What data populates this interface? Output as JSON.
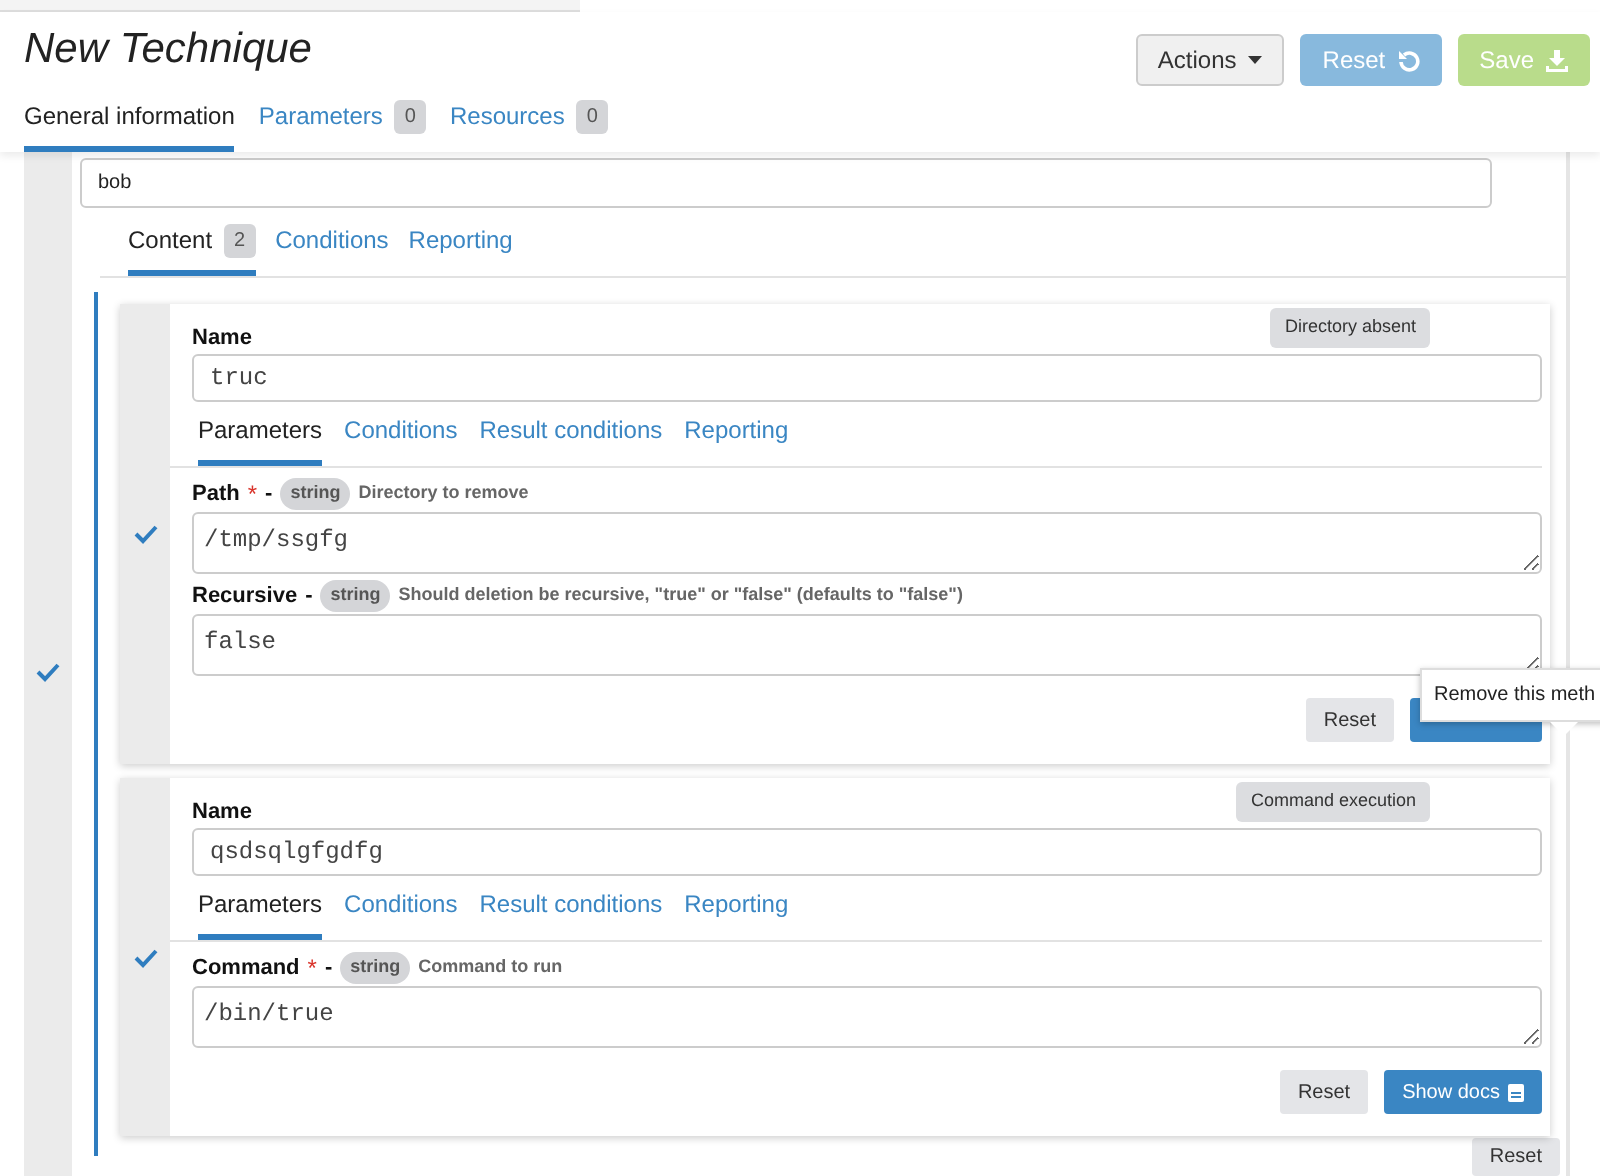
{
  "header": {
    "title": "New Technique",
    "actions": [
      {
        "label": "Actions",
        "kind": "dropdown",
        "disabled": false
      },
      {
        "label": "Reset",
        "kind": "reset",
        "disabled": true
      },
      {
        "label": "Save",
        "kind": "save",
        "disabled": true
      }
    ]
  },
  "tabs": [
    {
      "label": "General information",
      "selected": true
    },
    {
      "label": "Parameters",
      "count": "0",
      "selected": false
    },
    {
      "label": "Resources",
      "count": "0",
      "selected": false
    }
  ],
  "description": {
    "value": "bob"
  },
  "content_tabs": [
    {
      "label": "Content",
      "count": "2",
      "selected": true
    },
    {
      "label": "Conditions",
      "selected": false
    },
    {
      "label": "Reporting",
      "selected": false
    }
  ],
  "methods_valid": true,
  "methods": [
    {
      "badge": "Directory absent",
      "name_label": "Name",
      "name": "truc",
      "valid": true,
      "tabs": [
        {
          "label": "Parameters",
          "selected": true
        },
        {
          "label": "Conditions",
          "selected": false
        },
        {
          "label": "Result conditions",
          "selected": false
        },
        {
          "label": "Reporting",
          "selected": false
        }
      ],
      "parameters": [
        {
          "label": "Path",
          "required_mark": "*",
          "separator": "-",
          "type": "string",
          "description": "Directory to remove",
          "value": "/tmp/ssgfg"
        },
        {
          "label": "Recursive",
          "separator": "-",
          "type": "string",
          "description": "Should deletion be recursive, \"true\" or \"false\" (defaults to \"false\")",
          "value": "false"
        }
      ],
      "buttons": [
        {
          "label": "Reset",
          "kind": "plain"
        },
        {
          "kind": "primary"
        }
      ],
      "tooltip": "Remove this meth"
    },
    {
      "badge": "Command execution",
      "name_label": "Name",
      "name": "qsdsqlgfgdfg",
      "valid": true,
      "tabs": [
        {
          "label": "Parameters",
          "selected": true
        },
        {
          "label": "Conditions",
          "selected": false
        },
        {
          "label": "Result conditions",
          "selected": false
        },
        {
          "label": "Reporting",
          "selected": false
        }
      ],
      "parameters": [
        {
          "label": "Command",
          "required_mark": "*",
          "separator": "-",
          "type": "string",
          "description": "Command to run",
          "value": "/bin/true"
        }
      ],
      "buttons": [
        {
          "label": "Reset",
          "kind": "plain"
        },
        {
          "label": "Show docs",
          "kind": "docs"
        }
      ]
    }
  ],
  "footer_button": {
    "label": "Reset"
  }
}
